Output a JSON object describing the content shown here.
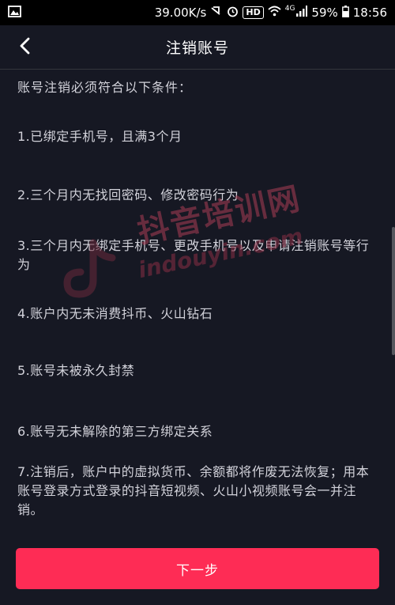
{
  "status_bar": {
    "speed": "39.00K/s",
    "hd": "HD",
    "network": "4G",
    "battery": "59%",
    "time": "18:56",
    "icons": [
      "image-icon",
      "vibrate-icon",
      "alarm-icon",
      "wifi-icon",
      "signal-icon",
      "battery-icon"
    ]
  },
  "nav": {
    "title": "注销账号",
    "back_icon": "chevron-left-icon"
  },
  "content": {
    "intro": "账号注销必须符合以下条件：",
    "conditions": [
      "1.已绑定手机号，且满3个月",
      "2.三个月内无找回密码、修改密码行为",
      "3.三个月内无绑定手机号、更改手机号以及申请注销账号等行为",
      "4.账户内无未消费抖币、火山钻石",
      "5.账号未被永久封禁",
      "6.账号无未解除的第三方绑定关系",
      "7.注销后，账户中的虚拟货币、余额都将作废无法恢复；用本账号登录方式登录的抖音短视频、火山小视频账号会一并注销。"
    ]
  },
  "watermark": {
    "cn": "抖音培训网",
    "en": "indouyin.com"
  },
  "footer": {
    "next_label": "下一步"
  },
  "colors": {
    "background": "#161823",
    "accent": "#fe2c55",
    "text": "#d2d2da",
    "title": "#ffffff"
  }
}
